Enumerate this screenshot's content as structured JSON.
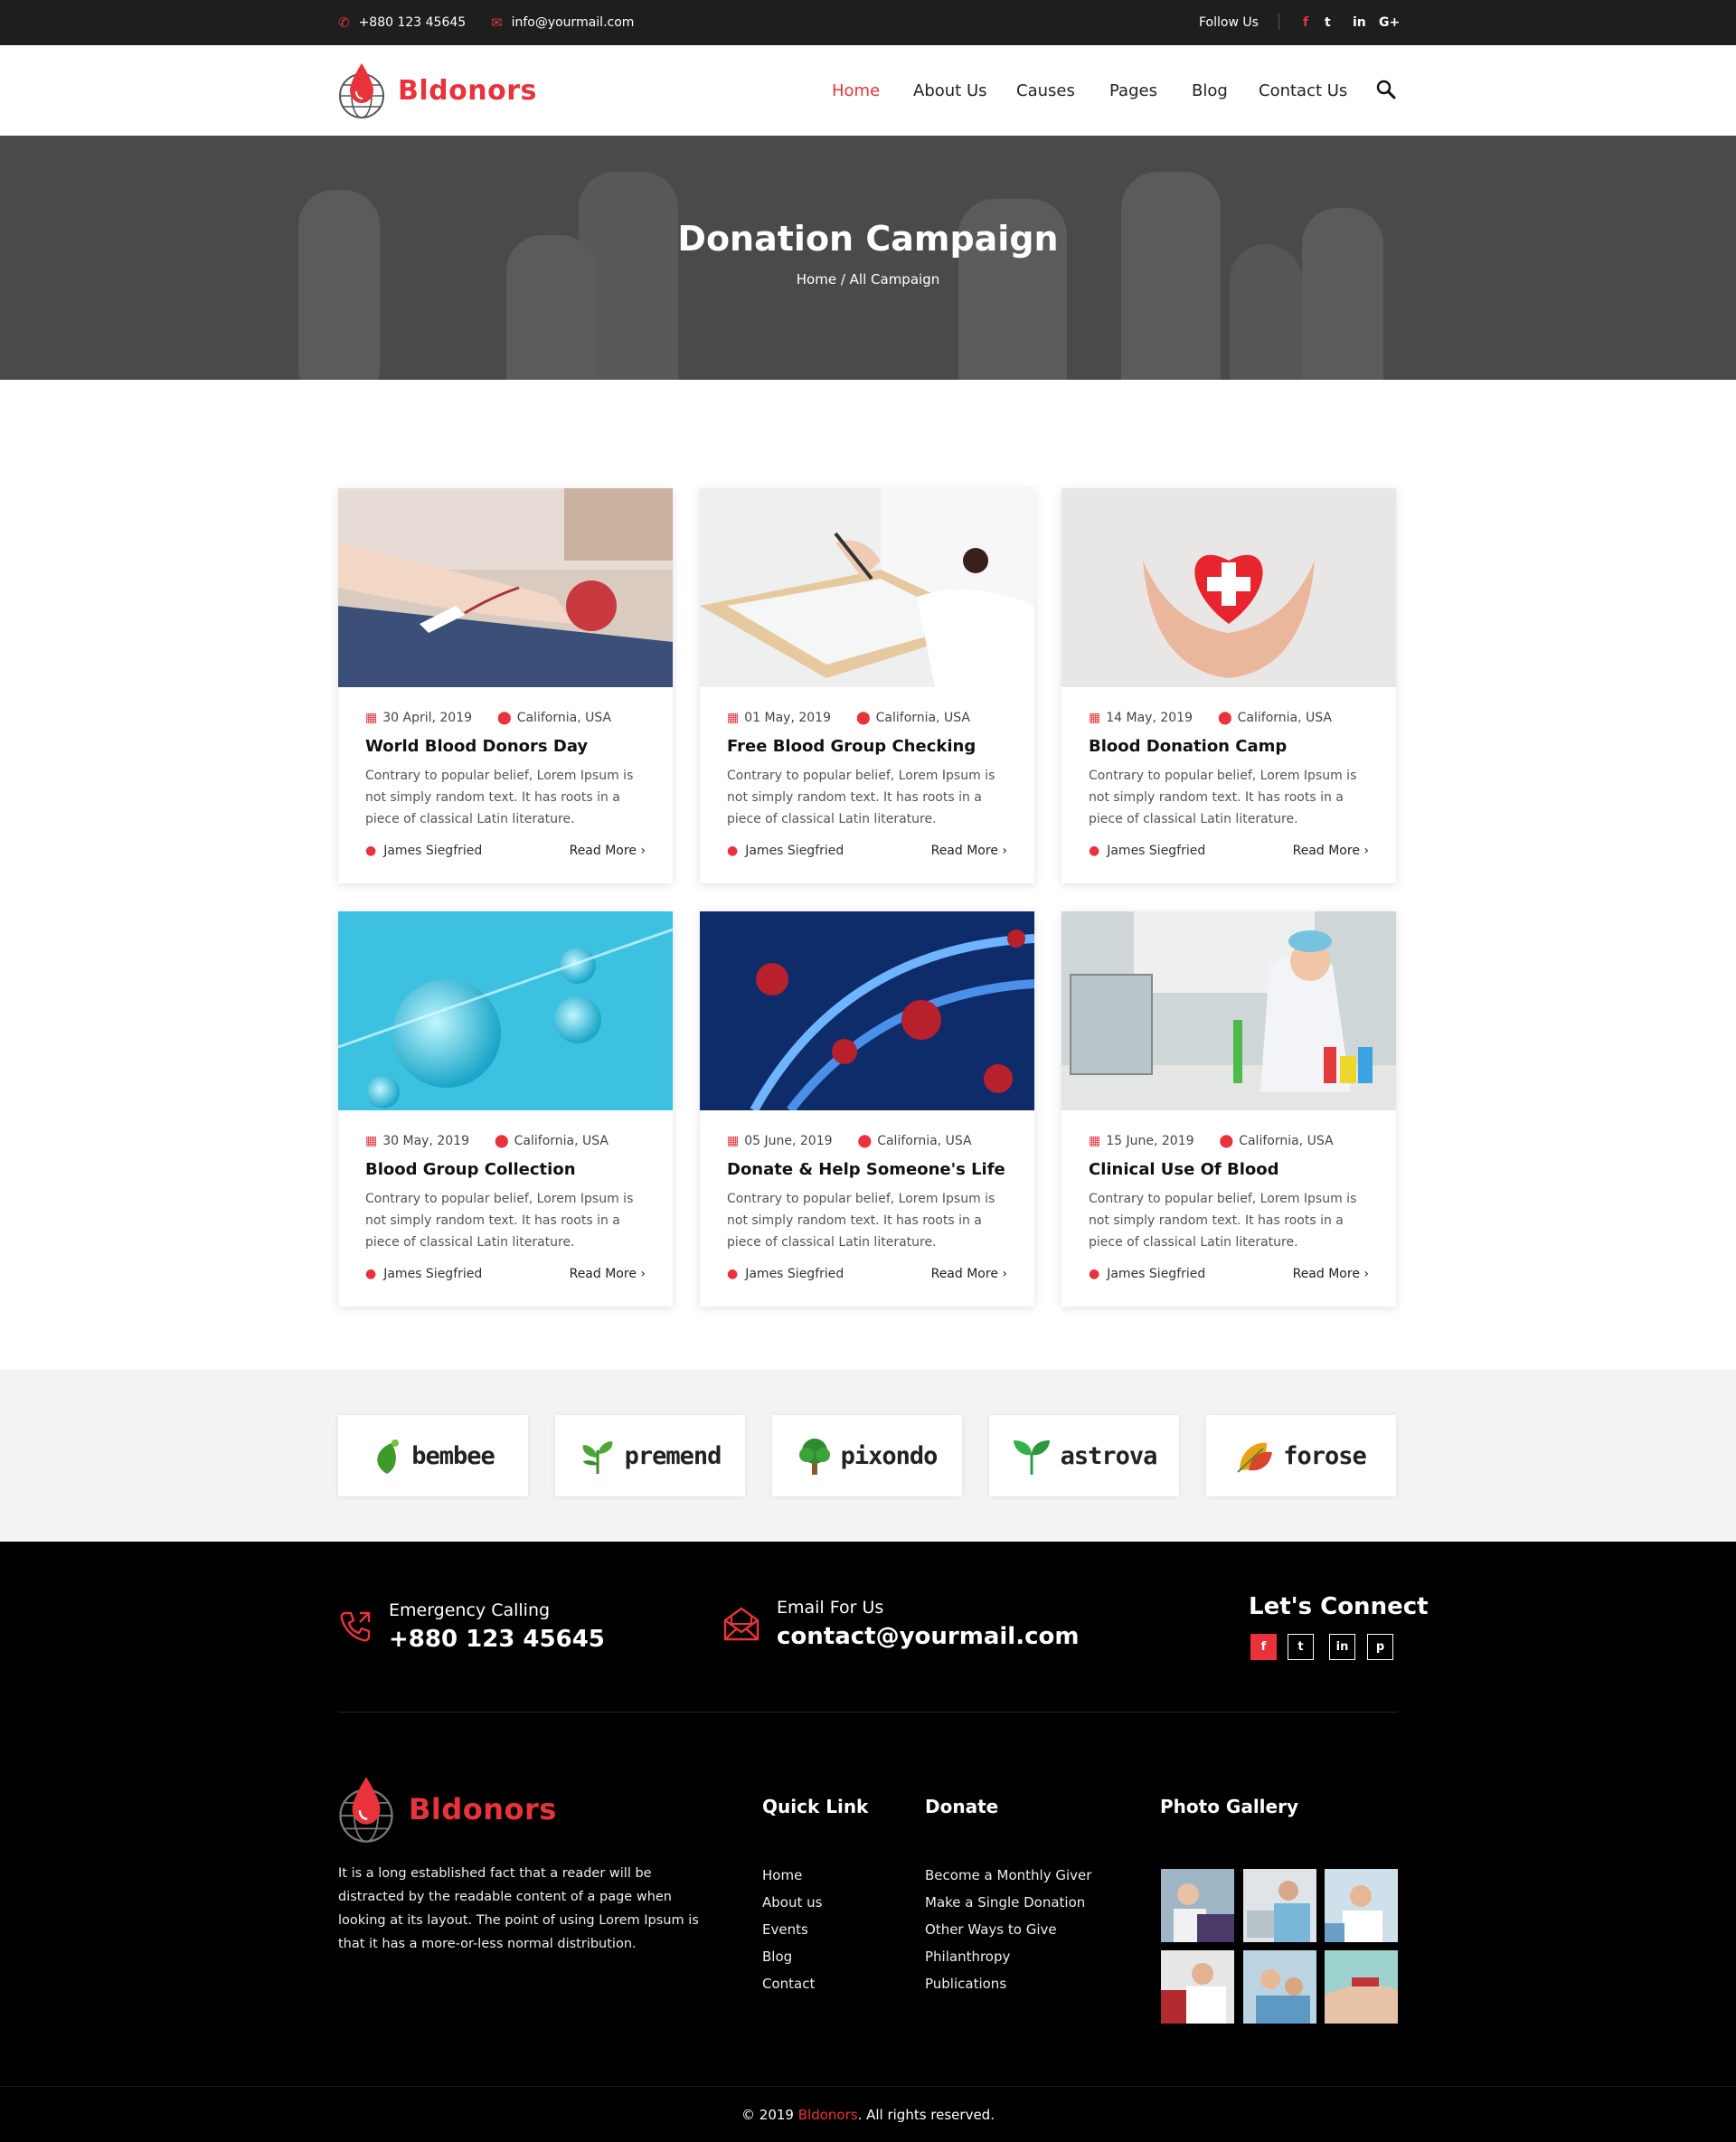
{
  "topbar": {
    "phone": "+880 123 45645",
    "email": "info@yourmail.com",
    "follow_label": "Follow Us",
    "social": [
      "f",
      "t",
      "in",
      "G+"
    ]
  },
  "header": {
    "brand": "Bldonors",
    "nav": [
      "Home",
      "About Us",
      "Causes",
      "Pages",
      "Blog",
      "Contact Us"
    ],
    "active_nav": "Home"
  },
  "hero": {
    "title": "Donation Campaign",
    "breadcrumb": "Home / All Campaign"
  },
  "campaigns": [
    {
      "date": "30 April, 2019",
      "location": "California, USA",
      "title": "World Blood Donors Day",
      "text": "Contrary to popular belief, Lorem Ipsum is not simply random text. It has roots in a piece of classical Latin literature.",
      "author": "James Siegfried",
      "more": "Read More"
    },
    {
      "date": "01 May, 2019",
      "location": "California, USA",
      "title": "Free Blood Group Checking",
      "text": "Contrary to popular belief, Lorem Ipsum is not simply random text. It has roots in a piece of classical Latin literature.",
      "author": "James Siegfried",
      "more": "Read More"
    },
    {
      "date": "14 May, 2019",
      "location": "California, USA",
      "title": "Blood Donation Camp",
      "text": "Contrary to popular belief, Lorem Ipsum is not simply random text. It has roots in a piece of classical Latin literature.",
      "author": "James Siegfried",
      "more": "Read More"
    },
    {
      "date": "30 May, 2019",
      "location": "California, USA",
      "title": "Blood Group Collection",
      "text": "Contrary to popular belief, Lorem Ipsum is not simply random text. It has roots in a piece of classical Latin literature.",
      "author": "James Siegfried",
      "more": "Read More"
    },
    {
      "date": "05 June, 2019",
      "location": "California, USA",
      "title": "Donate & Help Someone's Life",
      "text": "Contrary to popular belief, Lorem Ipsum is not simply random text. It has roots in a piece of classical Latin literature.",
      "author": "James Siegfried",
      "more": "Read More"
    },
    {
      "date": "15 June, 2019",
      "location": "California, USA",
      "title": "Clinical Use Of Blood",
      "text": "Contrary to popular belief, Lorem Ipsum is not simply random text. It has roots in a piece of classical Latin literature.",
      "author": "James Siegfried",
      "more": "Read More"
    }
  ],
  "partners": [
    "bembee",
    "premend",
    "pixondo",
    "astrova",
    "forose"
  ],
  "footer": {
    "emergency_label": "Emergency Calling",
    "emergency_phone": "+880 123 45645",
    "email_label": "Email For Us",
    "email_value": "contact@yourmail.com",
    "connect_title": "Let's Connect",
    "connect_social": [
      "f",
      "t",
      "in",
      "p"
    ],
    "brand": "Bldonors",
    "about": "It is a long established fact that a reader will be distracted by the readable content of a page when looking at its layout. The point of using Lorem Ipsum is that it has a more-or-less normal distribution.",
    "quick_title": "Quick Link",
    "quick_links": [
      "Home",
      "About us",
      "Events",
      "Blog",
      "Contact"
    ],
    "donate_title": "Donate",
    "donate_links": [
      "Become a Monthly Giver",
      "Make a Single Donation",
      "Other Ways to Give",
      "Philanthropy",
      "Publications"
    ],
    "gallery_title": "Photo Gallery",
    "copyright_pre": "© 2019 ",
    "copyright_brand": "Bldonors",
    "copyright_post": ". All rights reserved."
  },
  "colors": {
    "accent": "#e8333c",
    "dark": "#1e1e1e",
    "footer": "#000000"
  }
}
